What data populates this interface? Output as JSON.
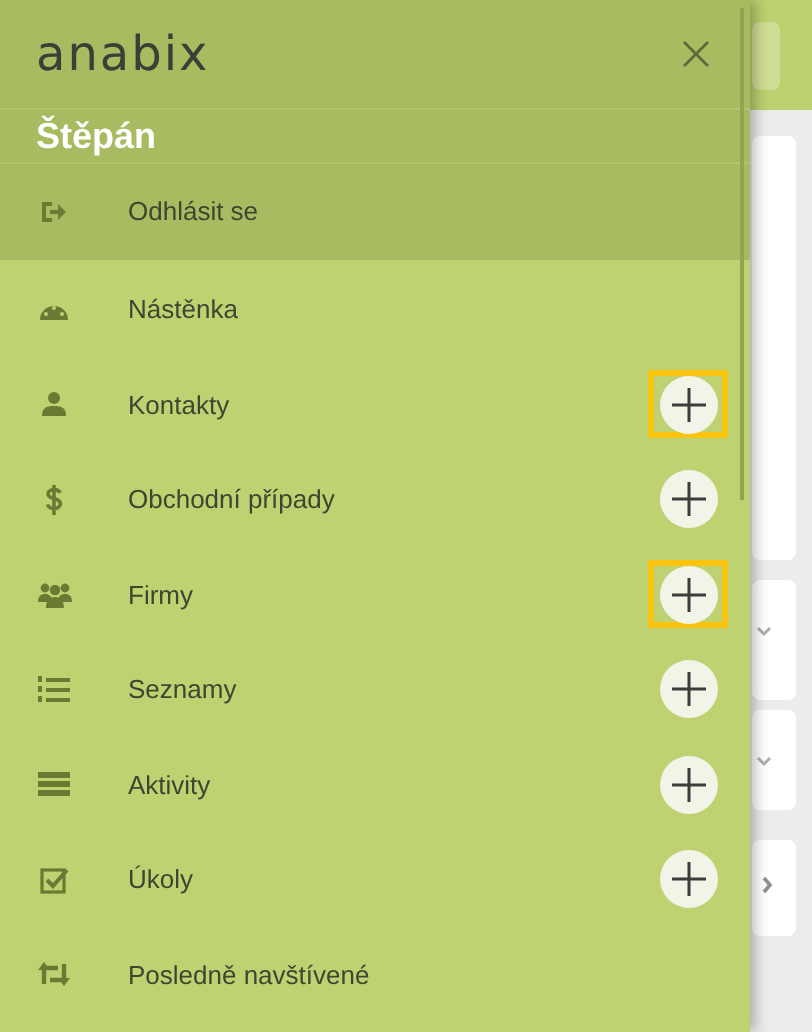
{
  "drawer": {
    "logo": "anabix",
    "user_name": "Štěpán",
    "logout": {
      "label": "Odhlásit se",
      "kind": "logout"
    },
    "items": [
      {
        "label": "Nástěnka",
        "kind": "dashboard"
      },
      {
        "label": "Kontakty",
        "kind": "person",
        "add_button": {
          "highlighted": true
        }
      },
      {
        "label": "Obchodní případy",
        "kind": "dollar",
        "add_button": {
          "highlighted": false
        }
      },
      {
        "label": "Firmy",
        "kind": "group",
        "add_button": {
          "highlighted": true
        }
      },
      {
        "label": "Seznamy",
        "kind": "list",
        "add_button": {
          "highlighted": false
        }
      },
      {
        "label": "Aktivity",
        "kind": "bars",
        "add_button": {
          "highlighted": false
        }
      },
      {
        "label": "Úkoly",
        "kind": "checkbox",
        "add_button": {
          "highlighted": false
        }
      },
      {
        "label": "Posledně navštívené",
        "kind": "retweet"
      }
    ]
  }
}
